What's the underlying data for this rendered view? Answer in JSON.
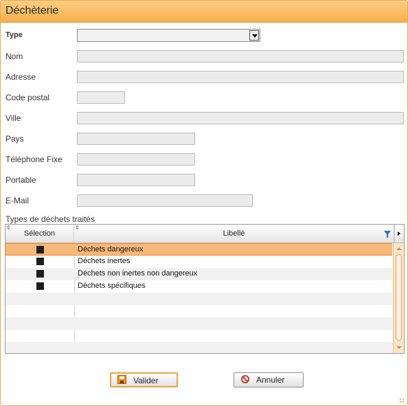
{
  "window": {
    "title": "Déchèterie"
  },
  "form": {
    "type_label": "Type",
    "type_value": "",
    "nom_label": "Nom",
    "adresse_label": "Adresse",
    "code_postal_label": "Code postal",
    "ville_label": "Ville",
    "pays_label": "Pays",
    "telephone_label": "Téléphone Fixe",
    "portable_label": "Portable",
    "email_label": "E-Mail"
  },
  "grid": {
    "section_title": "Types de déchets traités",
    "columns": [
      "Sélection",
      "Libellé"
    ],
    "rows": [
      {
        "label": "Déchets dangereux",
        "selected": true
      },
      {
        "label": "Déchets inertes",
        "selected": false
      },
      {
        "label": "Déchets non inertes non dangereux",
        "selected": false
      },
      {
        "label": "Déchets spécifiques",
        "selected": false
      }
    ]
  },
  "buttons": {
    "validate": "Valider",
    "cancel": "Annuler"
  },
  "colors": {
    "accent": "#f6b04b",
    "selection": "#f7b97a"
  }
}
